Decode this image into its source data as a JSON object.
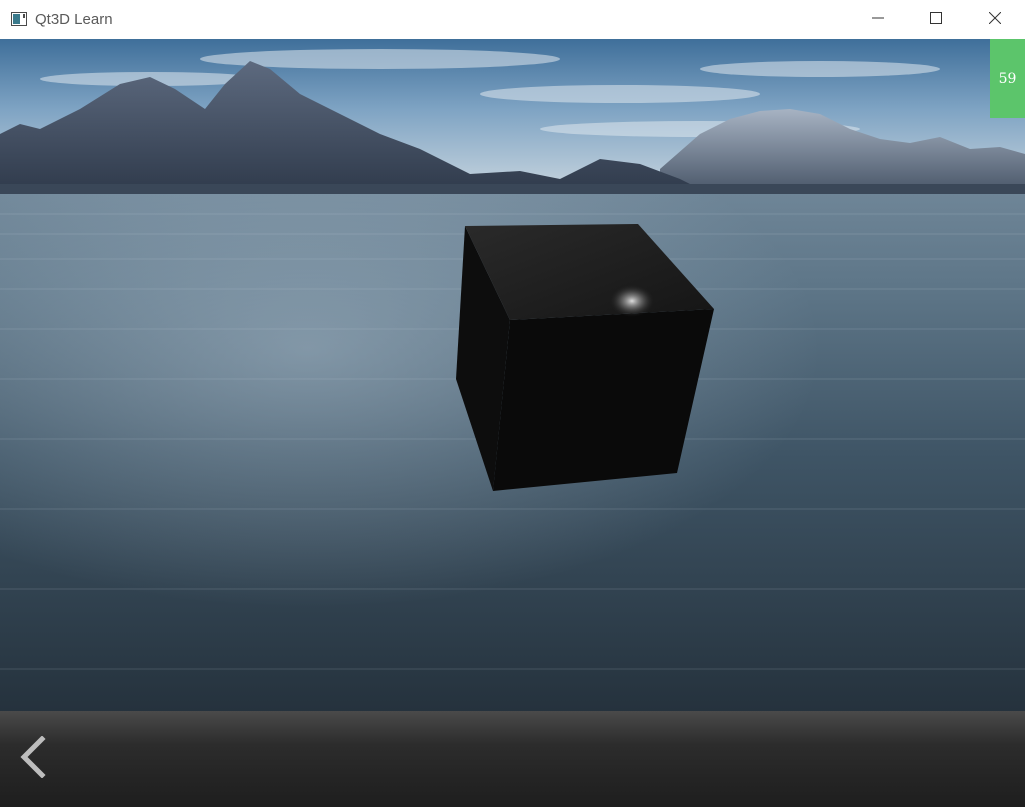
{
  "window": {
    "title": "Qt3D Learn",
    "icon": "app-window-icon",
    "controls": {
      "minimize_icon": "minimize-icon",
      "maximize_icon": "maximize-icon",
      "close_icon": "close-icon"
    }
  },
  "viewport": {
    "scene": "skybox-mountains-lake-with-cube",
    "fps": "59",
    "fps_badge_color": "#5cc56b"
  },
  "toolbar": {
    "back_icon": "chevron-left-icon"
  }
}
